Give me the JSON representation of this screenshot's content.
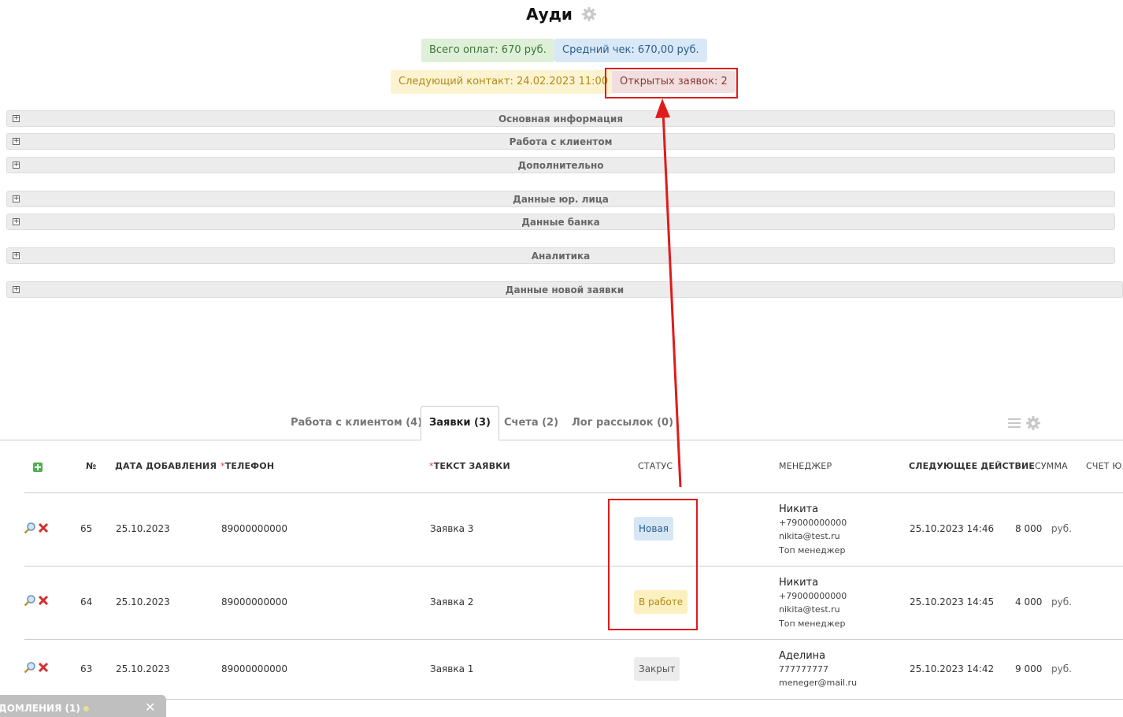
{
  "header": {
    "title": "Ауди",
    "badges": {
      "total": "Всего оплат: 670 руб.",
      "avg": "Средний чек: 670,00 руб.",
      "next": "Следующий контакт: 24.02.2023 11:00",
      "open": "Открытых заявок: 2"
    }
  },
  "sections": [
    "Основная информация",
    "Работа с клиентом",
    "Дополнительно",
    "Данные юр. лица",
    "Данные банка",
    "Аналитика",
    "Данные новой заявки"
  ],
  "tabs": [
    "Работа с клиентом (4)",
    "Заявки (3)",
    "Счета (2)",
    "Лог рассылок (0)"
  ],
  "table": {
    "headers": {
      "num": "№",
      "date": "ДАТА ДОБАВЛЕНИЯ",
      "phone": "ТЕЛЕФОН",
      "text": "ТЕКСТ ЗАЯВКИ",
      "status": "СТАТУС",
      "manager": "МЕНЕДЖЕР",
      "next": "СЛЕДУЮЩЕЕ ДЕЙСТВИЕ",
      "sum": "СУММА",
      "account": "СЧЕТ Ю."
    },
    "required_mark": "*",
    "rows": [
      {
        "num": "65",
        "date": "25.10.2023",
        "phone": "89000000000",
        "text": "Заявка 3",
        "status": "Новая",
        "manager": {
          "name": "Никита",
          "phone": "+79000000000",
          "email": "nikita@test.ru",
          "role": "Топ менеджер"
        },
        "next": "25.10.2023 14:46",
        "sum": "8 000",
        "currency": "руб."
      },
      {
        "num": "64",
        "date": "25.10.2023",
        "phone": "89000000000",
        "text": "Заявка 2",
        "status": "В работе",
        "manager": {
          "name": "Никита",
          "phone": "+79000000000",
          "email": "nikita@test.ru",
          "role": "Топ менеджер"
        },
        "next": "25.10.2023 14:45",
        "sum": "4 000",
        "currency": "руб."
      },
      {
        "num": "63",
        "date": "25.10.2023",
        "phone": "89000000000",
        "text": "Заявка 1",
        "status": "Закрыт",
        "manager": {
          "name": "Аделина",
          "phone": "777777777",
          "email": "meneger@mail.ru",
          "role": ""
        },
        "next": "25.10.2023 14:42",
        "sum": "9 000",
        "currency": "руб."
      }
    ]
  },
  "notification": {
    "label": "ДОМЛЕНИЯ (1)",
    "close": "✕"
  },
  "colors": {
    "annotation": "#e01b1b",
    "add_icon": "#4caf50",
    "delete_icon": "#d32f2f"
  }
}
